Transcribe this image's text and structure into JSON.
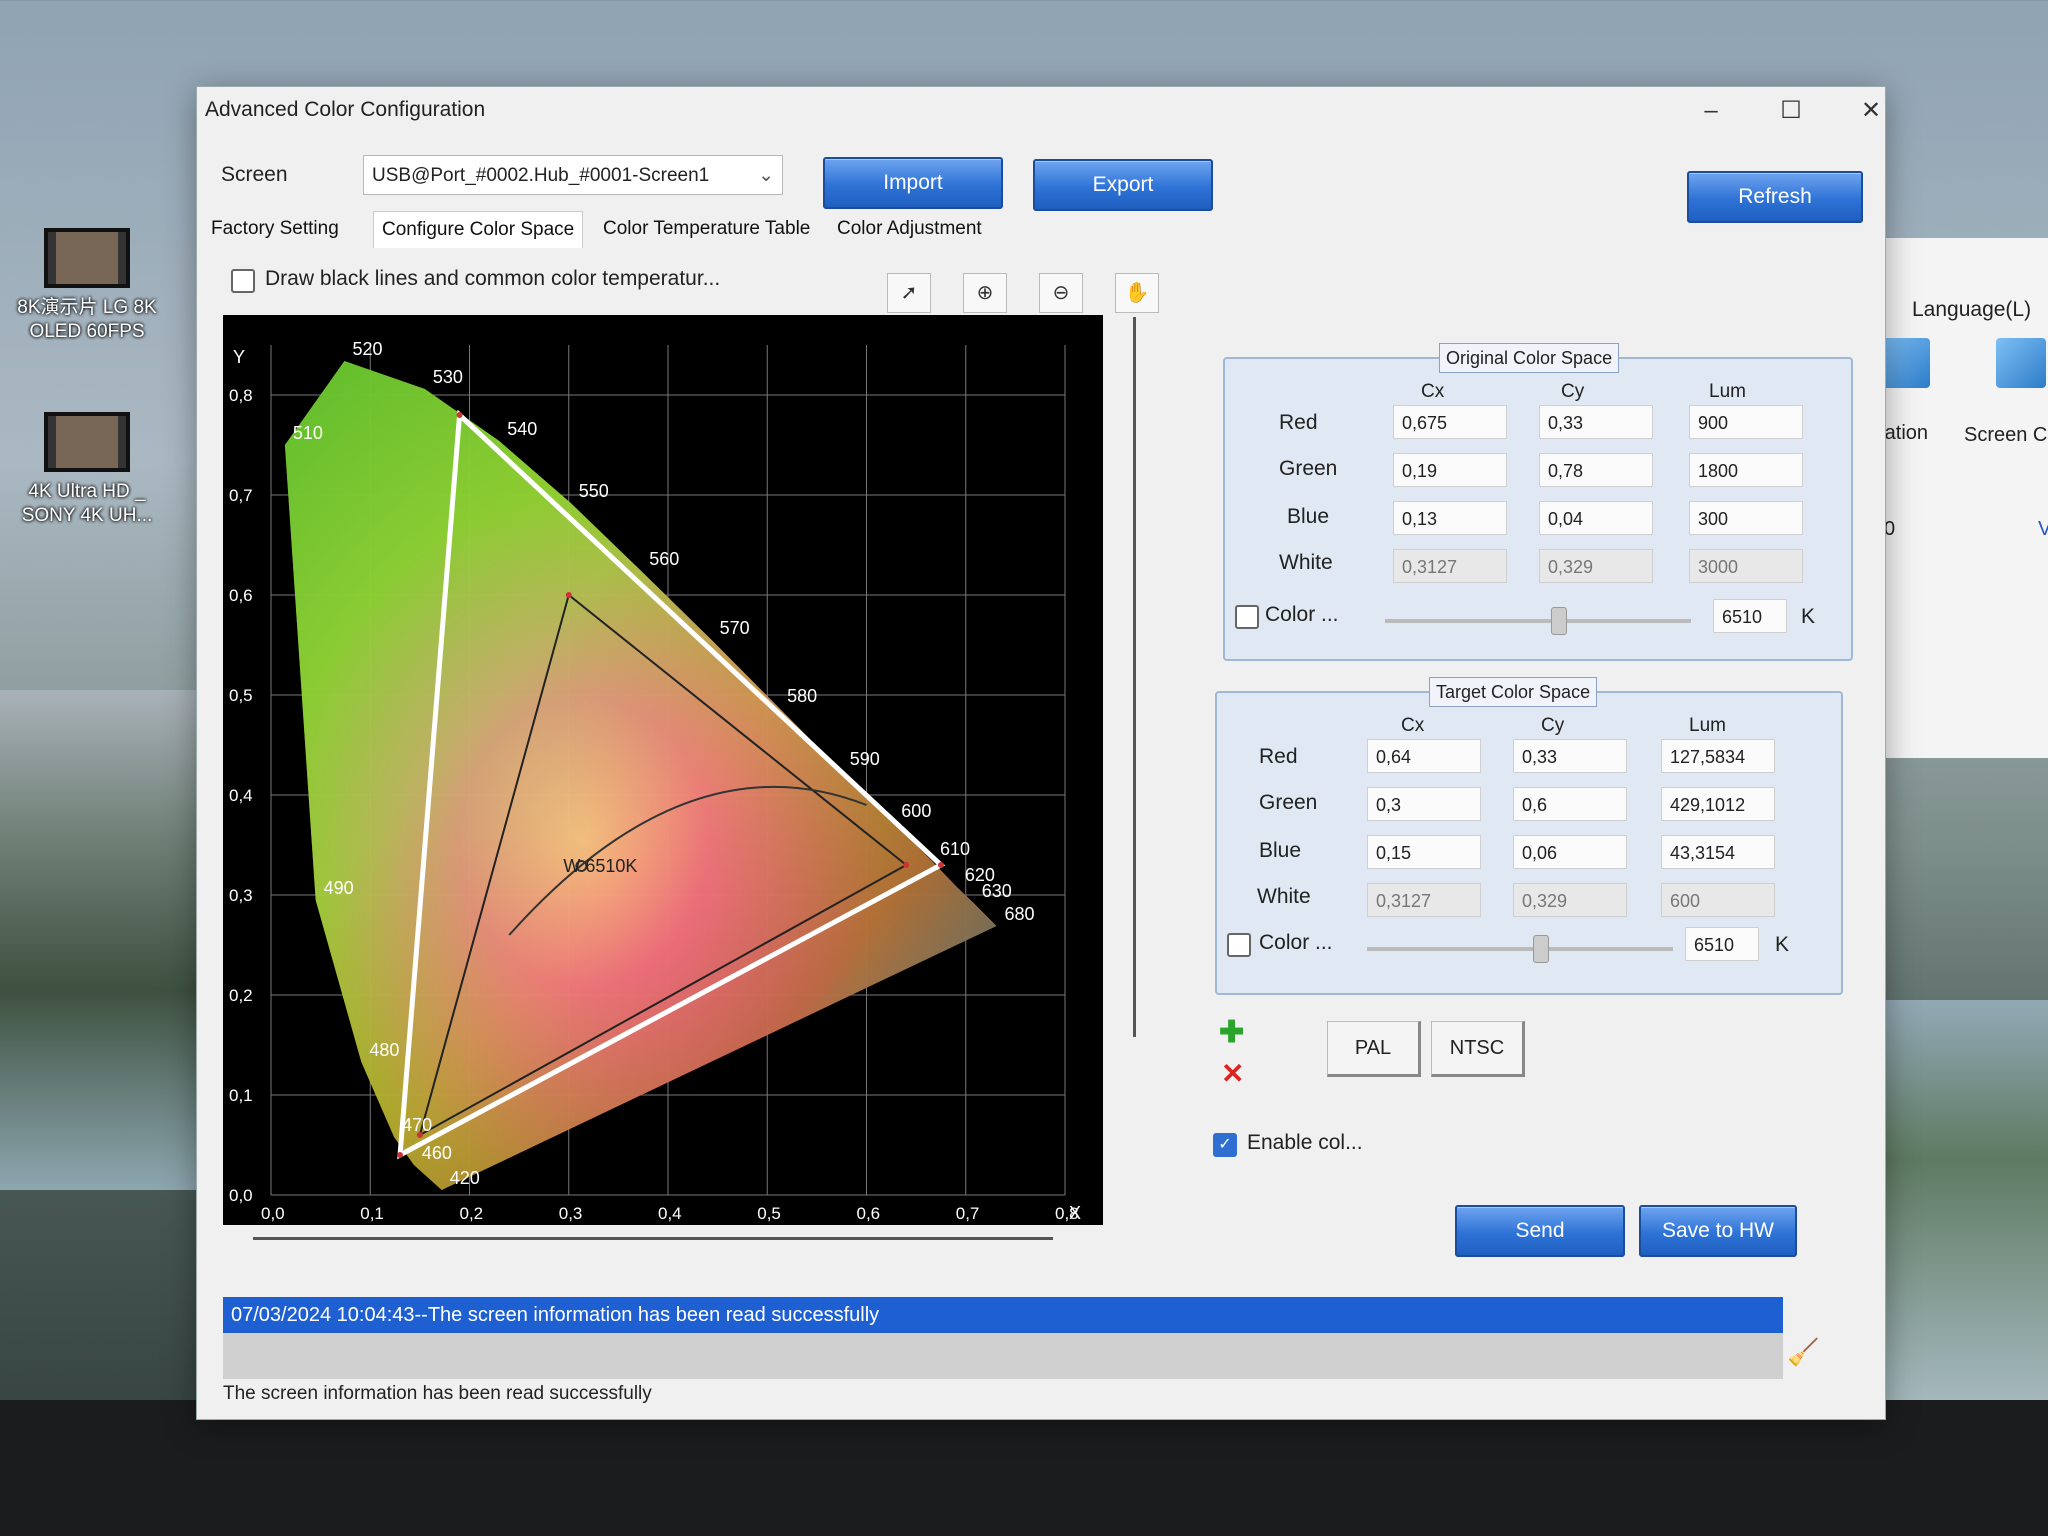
{
  "desktop": {
    "icons": [
      {
        "label": "8K演示片 LG 8K OLED 60FPS"
      },
      {
        "label": "4K Ultra HD _ SONY 4K UH..."
      }
    ]
  },
  "background_window": {
    "menu_language": "Language(L)",
    "label_left": "ration",
    "label_right": "Screen C",
    "value": "0",
    "value2": "V"
  },
  "window": {
    "title": "Advanced Color Configuration",
    "screen_label": "Screen",
    "screen_value": "USB@Port_#0002.Hub_#0001-Screen1",
    "import_label": "Import",
    "export_label": "Export",
    "refresh_label": "Refresh",
    "tabs": [
      "Factory Setting",
      "Configure Color Space",
      "Color Temperature Table",
      "Color Adjustment"
    ],
    "draw_lines_label": "Draw black lines and common color temperatur...",
    "original": {
      "title": "Original Color Space",
      "headers": [
        "Cx",
        "Cy",
        "Lum"
      ],
      "rows": [
        {
          "name": "Red",
          "cx": "0,675",
          "cy": "0,33",
          "lum": "900"
        },
        {
          "name": "Green",
          "cx": "0,19",
          "cy": "0,78",
          "lum": "1800"
        },
        {
          "name": "Blue",
          "cx": "0,13",
          "cy": "0,04",
          "lum": "300"
        },
        {
          "name": "White",
          "cx": "0,3127",
          "cy": "0,329",
          "lum": "3000"
        }
      ],
      "color_label": "Color ...",
      "temp_value": "6510",
      "temp_unit": "K"
    },
    "target": {
      "title": "Target Color Space",
      "headers": [
        "Cx",
        "Cy",
        "Lum"
      ],
      "rows": [
        {
          "name": "Red",
          "cx": "0,64",
          "cy": "0,33",
          "lum": "127,5834"
        },
        {
          "name": "Green",
          "cx": "0,3",
          "cy": "0,6",
          "lum": "429,1012"
        },
        {
          "name": "Blue",
          "cx": "0,15",
          "cy": "0,06",
          "lum": "43,3154"
        },
        {
          "name": "White",
          "cx": "0,3127",
          "cy": "0,329",
          "lum": "600"
        }
      ],
      "color_label": "Color ...",
      "temp_value": "6510",
      "temp_unit": "K"
    },
    "pal_label": "PAL",
    "ntsc_label": "NTSC",
    "enable_label": "Enable col...",
    "send_label": "Send",
    "save_label": "Save to HW",
    "status_line": "07/03/2024 10:04:43--The screen information has been read successfully",
    "footer_status": "The screen information has been read successfully"
  },
  "chart_data": {
    "type": "scatter",
    "title": "",
    "xlabel": "X",
    "ylabel": "Y",
    "xlim": [
      0.0,
      0.8
    ],
    "ylim": [
      0.0,
      0.85
    ],
    "x_ticks": [
      "0,0",
      "0,1",
      "0,2",
      "0,3",
      "0,4",
      "0,5",
      "0,6",
      "0,7",
      "0,8"
    ],
    "y_ticks": [
      "0,0",
      "0,1",
      "0,2",
      "0,3",
      "0,4",
      "0,5",
      "0,6",
      "0,7",
      "0,8"
    ],
    "locus_labels": [
      {
        "nm": "420",
        "x": 0.172,
        "y": 0.005
      },
      {
        "nm": "460",
        "x": 0.144,
        "y": 0.03
      },
      {
        "nm": "470",
        "x": 0.124,
        "y": 0.058
      },
      {
        "nm": "480",
        "x": 0.091,
        "y": 0.133
      },
      {
        "nm": "490",
        "x": 0.045,
        "y": 0.295
      },
      {
        "nm": "510",
        "x": 0.014,
        "y": 0.75
      },
      {
        "nm": "520",
        "x": 0.074,
        "y": 0.834
      },
      {
        "nm": "530",
        "x": 0.155,
        "y": 0.806
      },
      {
        "nm": "540",
        "x": 0.23,
        "y": 0.754
      },
      {
        "nm": "550",
        "x": 0.302,
        "y": 0.692
      },
      {
        "nm": "560",
        "x": 0.373,
        "y": 0.624
      },
      {
        "nm": "570",
        "x": 0.444,
        "y": 0.555
      },
      {
        "nm": "580",
        "x": 0.512,
        "y": 0.487
      },
      {
        "nm": "590",
        "x": 0.575,
        "y": 0.424
      },
      {
        "nm": "600",
        "x": 0.627,
        "y": 0.372
      },
      {
        "nm": "610",
        "x": 0.666,
        "y": 0.334
      },
      {
        "nm": "620",
        "x": 0.691,
        "y": 0.308
      },
      {
        "nm": "630",
        "x": 0.708,
        "y": 0.292
      },
      {
        "nm": "680",
        "x": 0.731,
        "y": 0.269
      }
    ],
    "series": [
      {
        "name": "Original Color Space",
        "points": [
          [
            0.675,
            0.33
          ],
          [
            0.19,
            0.78
          ],
          [
            0.13,
            0.04
          ]
        ]
      },
      {
        "name": "Target Color Space",
        "points": [
          [
            0.64,
            0.33
          ],
          [
            0.3,
            0.6
          ],
          [
            0.15,
            0.06
          ]
        ]
      }
    ],
    "white_point": {
      "label": "W 6510K",
      "x": 0.3127,
      "y": 0.329
    },
    "grid": true
  }
}
